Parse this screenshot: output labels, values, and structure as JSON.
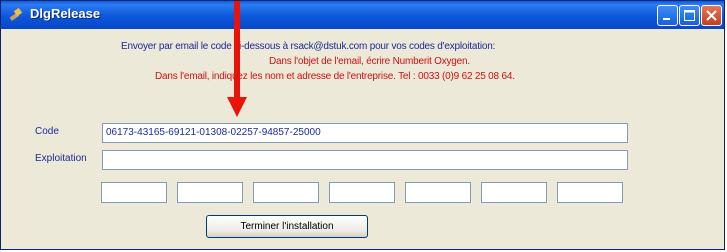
{
  "window": {
    "title": "DlgRelease"
  },
  "info": {
    "line1": "Envoyer par email le code ci-dessous à rsack@dstuk.com   pour vos codes d'exploitation:",
    "line2": "Dans l'objet de l'email, écrire Numberit Oxygen.",
    "line3": "Dans l'email, indiquez les nom et adresse de l'entreprise. Tel : 0033 (0)9 62 25 08 64."
  },
  "form": {
    "code_label": "Code",
    "code_value": "06173-43165-69121-01308-02257-94857-25000",
    "exploitation_label": "Exploitation",
    "exploitation_value": "",
    "codes": [
      "",
      "",
      "",
      "",
      "",
      "",
      ""
    ]
  },
  "buttons": {
    "finish_label": "Terminer l'installation"
  },
  "colors": {
    "accent_arrow": "#e8140a",
    "info_blue": "#1a2a9c",
    "info_red": "#d01010"
  }
}
